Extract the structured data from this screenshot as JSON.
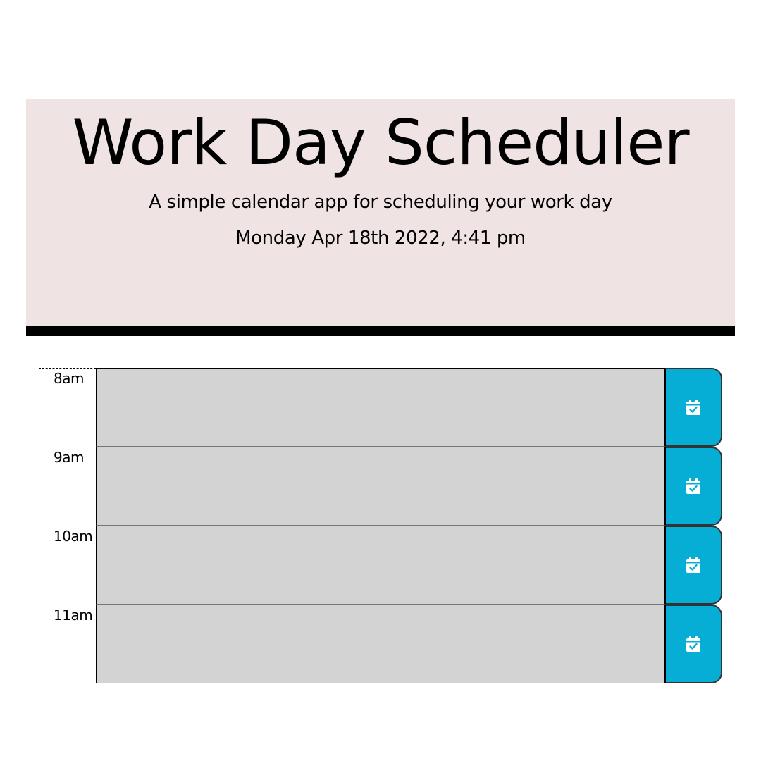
{
  "header": {
    "title": "Work Day Scheduler",
    "subtitle": "A simple calendar app for scheduling your work day",
    "current_day": "Monday Apr 18th 2022, 4:41 pm"
  },
  "colors": {
    "jumbotron_bg": "#efe3e4",
    "past_block": "#d3d3d3",
    "save_button": "#06aed5"
  },
  "time_blocks": [
    {
      "hour": "8am",
      "description": "",
      "save_icon": "calendar-check-icon"
    },
    {
      "hour": "9am",
      "description": "",
      "save_icon": "calendar-check-icon"
    },
    {
      "hour": "10am",
      "description": "",
      "save_icon": "calendar-check-icon"
    },
    {
      "hour": "11am",
      "description": "",
      "save_icon": "calendar-check-icon"
    }
  ]
}
